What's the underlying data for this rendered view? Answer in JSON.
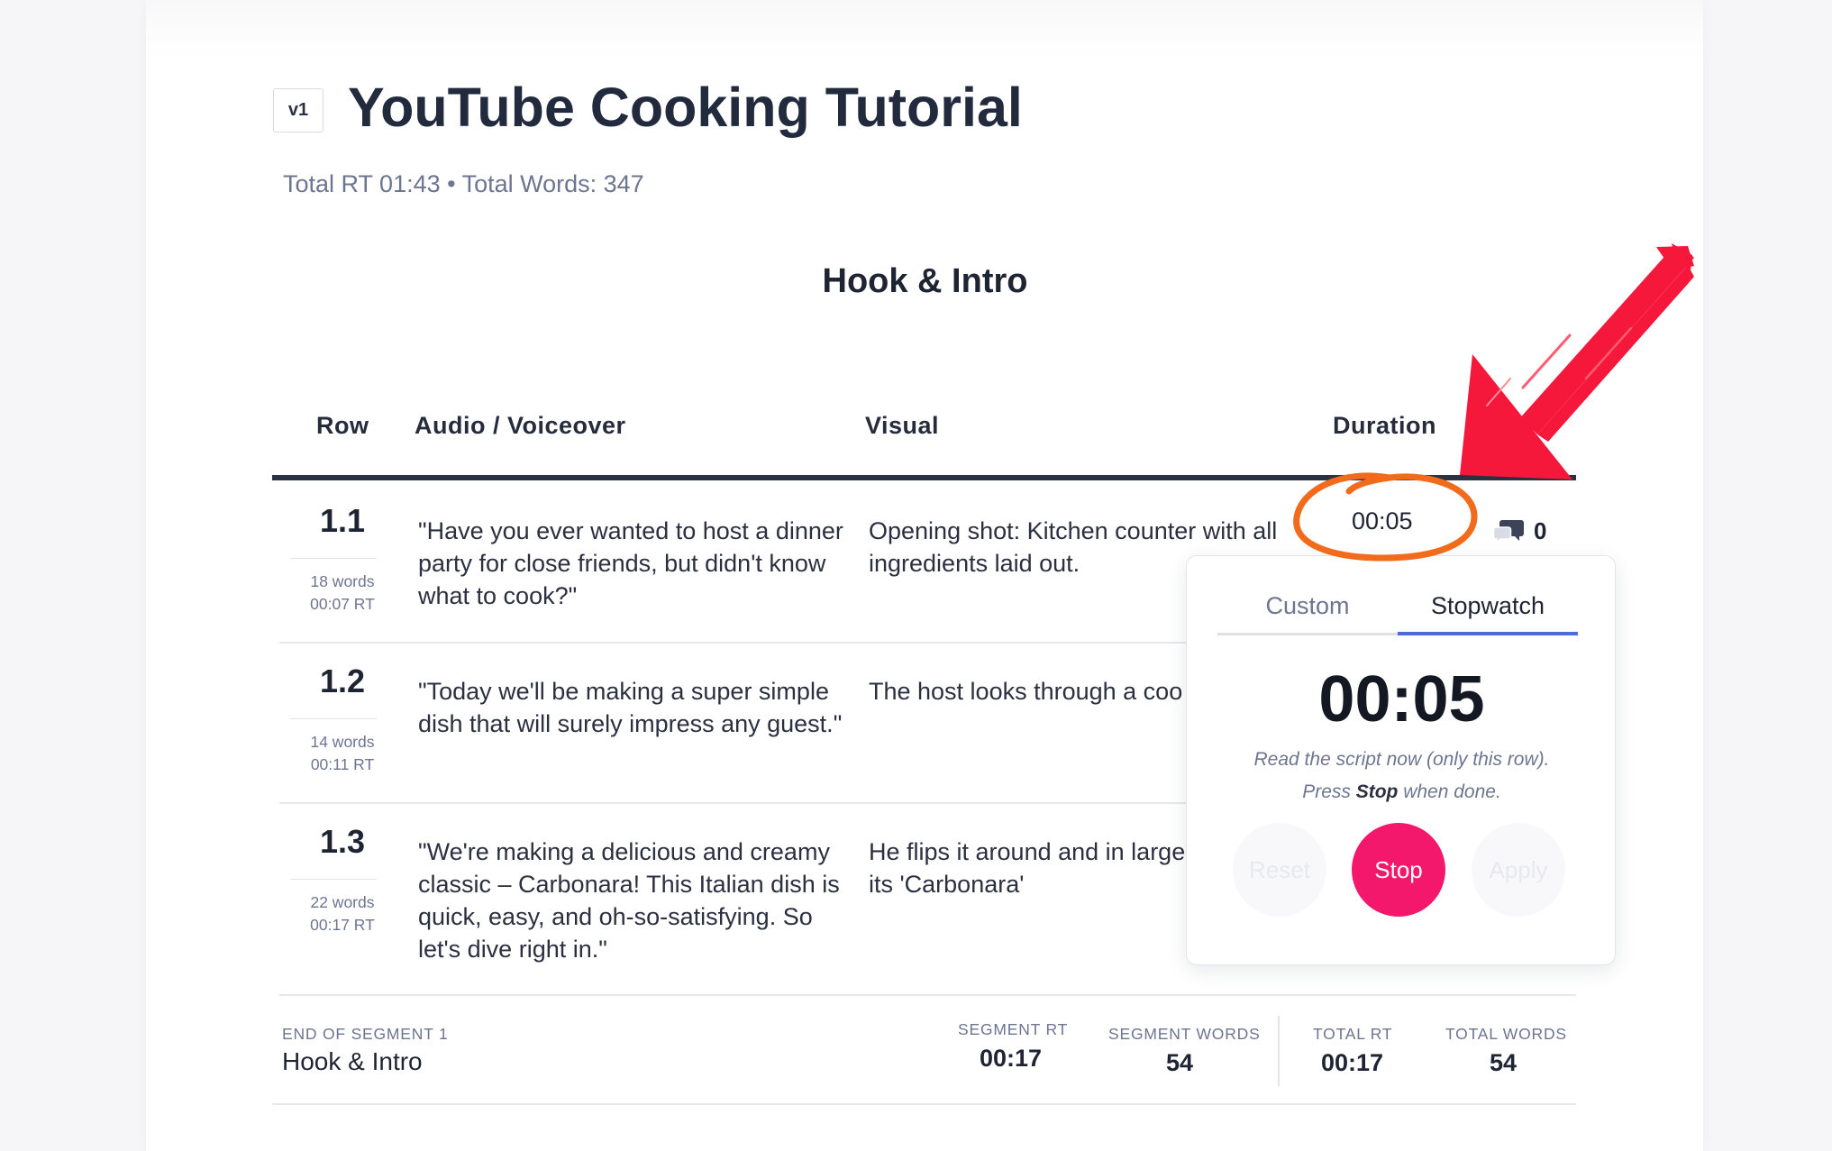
{
  "script": {
    "version": "v1",
    "title": "YouTube Cooking Tutorial",
    "summary": "Total RT 01:43 • Total Words: 347"
  },
  "segment": {
    "title": "Hook & Intro"
  },
  "table": {
    "headers": {
      "row": "Row",
      "audio": "Audio / Voiceover",
      "visual": "Visual",
      "duration": "Duration"
    },
    "rows": [
      {
        "num": "1.1",
        "words": "18 words",
        "rt": "00:07 RT",
        "audio": "\"Have you ever wanted to  host a dinner party for close friends, but didn't know what to cook?\"",
        "visual_line1": "Opening shot: Kitchen counter with all",
        "visual_line2": "ingredients laid out.",
        "duration": "00:05",
        "comments": "0"
      },
      {
        "num": "1.2",
        "words": "14 words",
        "rt": "00:11 RT",
        "audio": "\"Today we'll be making a super simple dish that will surely impress any guest.\"",
        "visual_line1": "The host looks through a coo",
        "visual_line2": ""
      },
      {
        "num": "1.3",
        "words": "22 words",
        "rt": "00:17 RT",
        "audio": "\"We're making a delicious and creamy classic – Carbonara! This Italian dish is quick, easy, and oh-so-satisfying. So let's dive right in.\"",
        "visual_line1": "He flips it around and in large",
        "visual_line2": "its 'Carbonara'"
      }
    ]
  },
  "timer_popover": {
    "tabs": [
      "Custom",
      "Stopwatch"
    ],
    "active_tab": "Stopwatch",
    "time": "00:05",
    "hint_line1": "Read the script now (only this row).",
    "hint_line2_pre": "Press ",
    "hint_line2_bold": "Stop",
    "hint_line2_post": " when done.",
    "buttons": {
      "reset": "Reset",
      "stop": "Stop",
      "apply": "Apply"
    },
    "stop_color": "#f4186d"
  },
  "footer": {
    "end_label": "END OF SEGMENT 1",
    "segment_name": "Hook & Intro",
    "segment_rt_label": "SEGMENT RT",
    "segment_rt": "00:17",
    "segment_words_label": "SEGMENT WORDS",
    "segment_words": "54",
    "total_rt_label": "TOTAL RT",
    "total_rt": "00:17",
    "total_words_label": "TOTAL WORDS",
    "total_words": "54"
  },
  "annotations": {
    "arrow_color": "#f5183a",
    "circle_color": "#f26a1b"
  }
}
